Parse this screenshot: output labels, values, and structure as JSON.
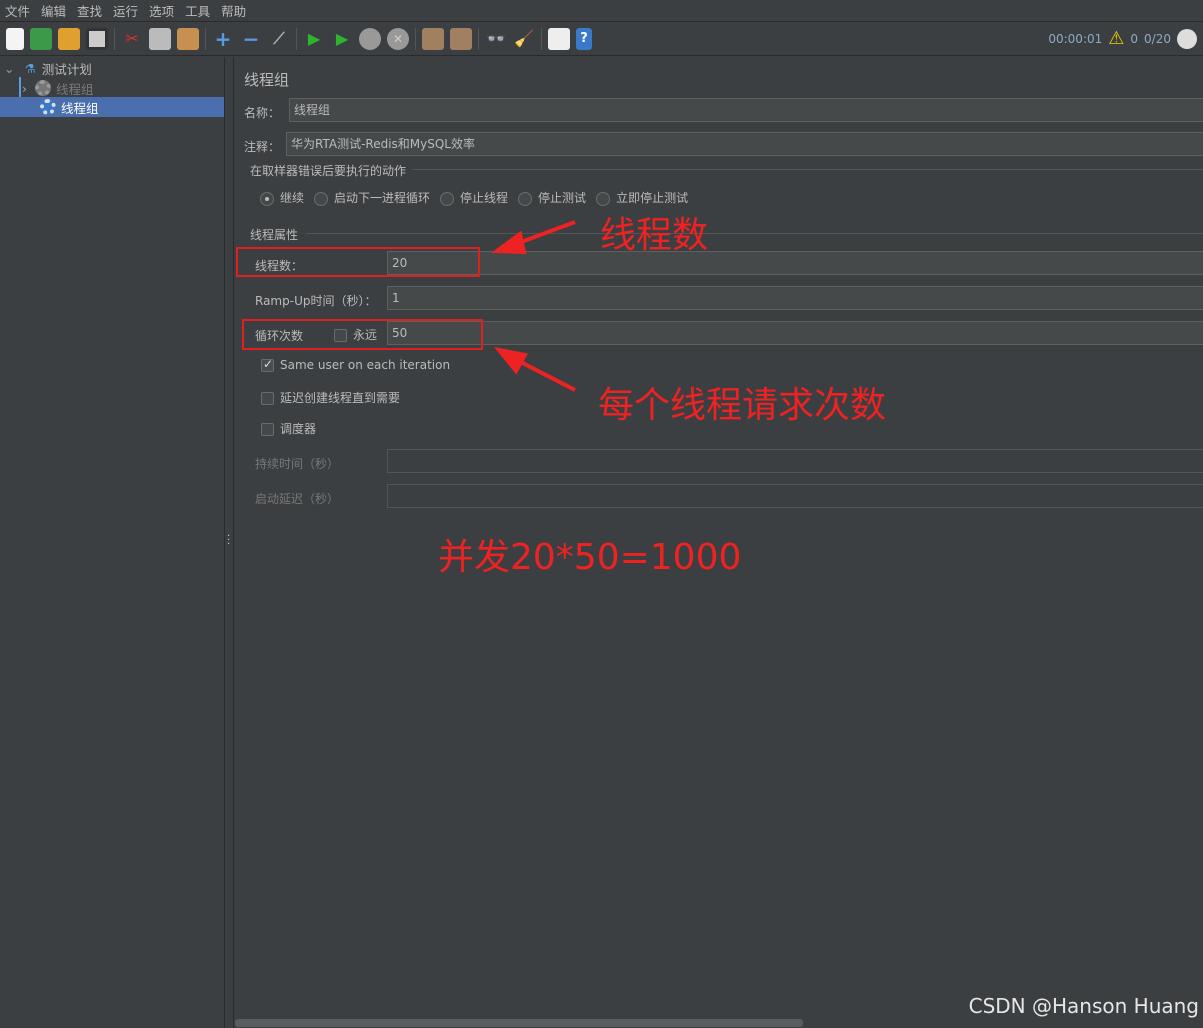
{
  "menu": [
    "文件",
    "编辑",
    "查找",
    "运行",
    "选项",
    "工具",
    "帮助"
  ],
  "toolbar_icons": [
    "new-icon",
    "templates-icon",
    "open-icon",
    "save-icon",
    "cut-icon",
    "copy-icon",
    "paste-icon",
    "expand-icon",
    "collapse-icon",
    "toggle-icon",
    "start-icon",
    "start-no-pause-icon",
    "stop-icon",
    "shutdown-icon",
    "clear-icon",
    "clear-all-icon",
    "search-icon",
    "reset-search-icon",
    "function-helper-icon",
    "help-icon"
  ],
  "status": {
    "elapsed": "00:00:01",
    "warnings": "0",
    "threads": "0/20"
  },
  "tree": {
    "root": "测试计划",
    "items": [
      {
        "label": "线程组",
        "disabled": true
      },
      {
        "label": "线程组",
        "selected": true
      }
    ]
  },
  "panel": {
    "title": "线程组",
    "name_label": "名称：",
    "name_value": "线程组",
    "comment_label": "注释：",
    "comment_value": "华为RTA测试-Redis和MySQL效率",
    "error_action_legend": "在取样器错误后要执行的动作",
    "error_actions": [
      {
        "label": "继续",
        "selected": true
      },
      {
        "label": "启动下一进程循环",
        "selected": false
      },
      {
        "label": "停止线程",
        "selected": false
      },
      {
        "label": "停止测试",
        "selected": false
      },
      {
        "label": "立即停止测试",
        "selected": false
      }
    ],
    "thread_props_legend": "线程属性",
    "threads_label": "线程数：",
    "threads_value": "20",
    "rampup_label": "Ramp-Up时间（秒）：",
    "rampup_value": "1",
    "loop_label": "循环次数",
    "forever_label": "永远",
    "forever_checked": false,
    "loop_value": "50",
    "same_user_label": "Same user on each iteration",
    "same_user_checked": true,
    "delay_label": "延迟创建线程直到需要",
    "delay_checked": false,
    "scheduler_label": "调度器",
    "scheduler_checked": false,
    "duration_label": "持续时间（秒）",
    "duration_value": "",
    "startup_delay_label": "启动延迟（秒）",
    "startup_delay_value": ""
  },
  "annotations": {
    "threads_note": "线程数",
    "loops_note": "每个线程请求次数",
    "concurrency_note": "并发20*50=1000",
    "color": "#ee2222"
  },
  "watermark": "CSDN @Hanson Huang"
}
